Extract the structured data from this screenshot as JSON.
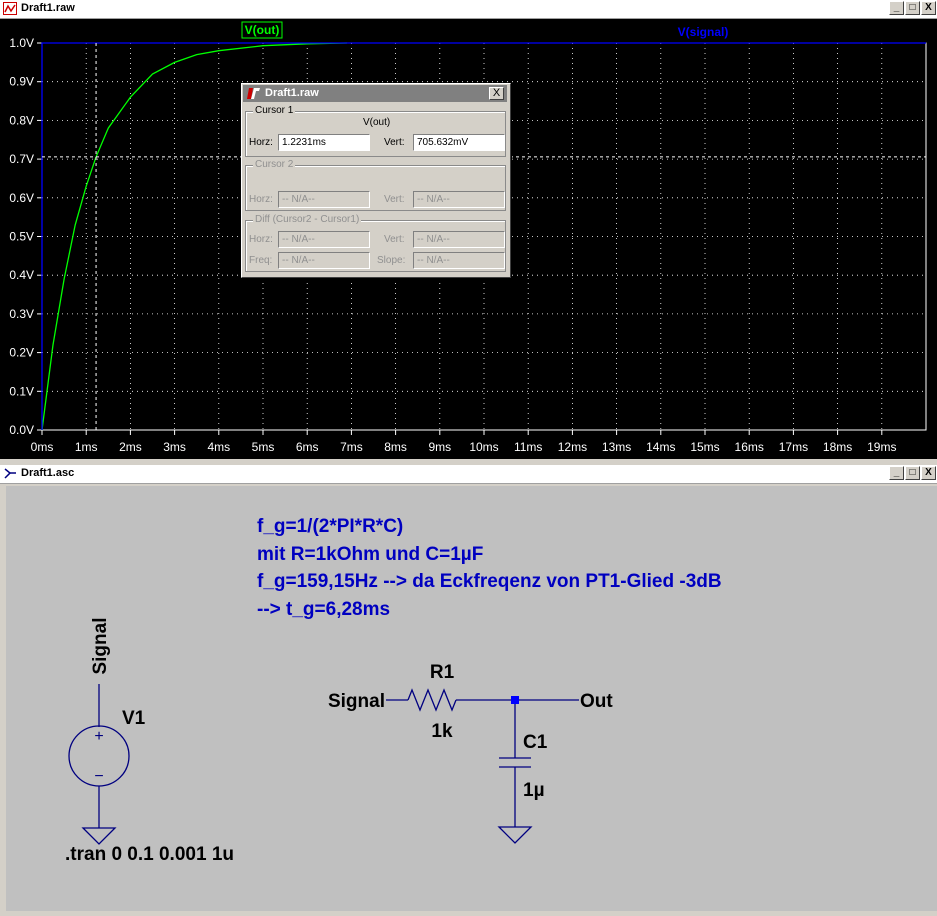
{
  "waveform_window": {
    "title": "Draft1.raw",
    "trace_labels": {
      "vout": "V(out)",
      "vsignal": "V(signal)"
    },
    "buttons": {
      "minimize": "_",
      "restore": "□",
      "close": "X"
    }
  },
  "chart_data": {
    "type": "line",
    "y_ticks": [
      "0.0V",
      "0.1V",
      "0.2V",
      "0.3V",
      "0.4V",
      "0.5V",
      "0.6V",
      "0.7V",
      "0.8V",
      "0.9V",
      "1.0V"
    ],
    "x_ticks": [
      "0ms",
      "1ms",
      "2ms",
      "3ms",
      "4ms",
      "5ms",
      "6ms",
      "7ms",
      "8ms",
      "9ms",
      "10ms",
      "11ms",
      "12ms",
      "13ms",
      "14ms",
      "15ms",
      "16ms",
      "17ms",
      "18ms",
      "19ms"
    ],
    "xlim": [
      0,
      20
    ],
    "ylim": [
      0,
      1
    ],
    "series": [
      {
        "name": "V(out)",
        "color": "#00ff00",
        "points": [
          [
            0,
            0
          ],
          [
            0.25,
            0.22
          ],
          [
            0.5,
            0.39
          ],
          [
            0.75,
            0.53
          ],
          [
            1.0,
            0.63
          ],
          [
            1.2231,
            0.706
          ],
          [
            1.5,
            0.78
          ],
          [
            2.0,
            0.86
          ],
          [
            2.5,
            0.92
          ],
          [
            3.0,
            0.95
          ],
          [
            3.5,
            0.97
          ],
          [
            4.0,
            0.98
          ],
          [
            5.0,
            0.993
          ],
          [
            6.0,
            0.998
          ],
          [
            6.9,
            1.0
          ]
        ]
      },
      {
        "name": "V(signal)",
        "color": "#0000ff",
        "points": [
          [
            0,
            0
          ],
          [
            0.001,
            1.0
          ],
          [
            20,
            1.0
          ]
        ]
      }
    ],
    "cursor": {
      "x": 1.2231,
      "y": 0.705632,
      "color": "#ffffff"
    }
  },
  "cursor_dialog": {
    "title": "Draft1.raw",
    "close": "X",
    "cursor1": {
      "legend": "Cursor 1",
      "trace": "V(out)",
      "horz_label": "Horz:",
      "horz_value": "1.2231ms",
      "vert_label": "Vert:",
      "vert_value": "705.632mV"
    },
    "cursor2": {
      "legend": "Cursor 2",
      "horz_label": "Horz:",
      "horz_value": "-- N/A--",
      "vert_label": "Vert:",
      "vert_value": "-- N/A--"
    },
    "diff": {
      "legend": "Diff (Cursor2 - Cursor1)",
      "horz_label": "Horz:",
      "horz_value": "-- N/A--",
      "vert_label": "Vert:",
      "vert_value": "-- N/A--",
      "freq_label": "Freq:",
      "freq_value": "-- N/A--",
      "slope_label": "Slope:",
      "slope_value": "-- N/A--"
    }
  },
  "schematic_window": {
    "title": "Draft1.asc",
    "buttons": {
      "minimize": "_",
      "restore": "□",
      "close": "X"
    },
    "notes": [
      "f_g=1/(2*PI*R*C)",
      "mit R=1kOhm und C=1µF",
      "f_g=159,15Hz --> da Eckfreqenz von PT1-Glied -3dB",
      "--> t_g=6,28ms"
    ],
    "source": {
      "net_label": "Signal",
      "name": "V1",
      "plus": "+",
      "minus": "−"
    },
    "resistor": {
      "name": "R1",
      "value": "1k"
    },
    "capacitor": {
      "name": "C1",
      "value": "1µ"
    },
    "in_label": "Signal",
    "out_label": "Out",
    "directive": ".tran 0 0.1 0.001 1u"
  },
  "colors": {
    "wire": "#000080",
    "text": "#000000",
    "note": "#0000c0",
    "plot_bg": "#000000",
    "grid": "#ffffff"
  }
}
